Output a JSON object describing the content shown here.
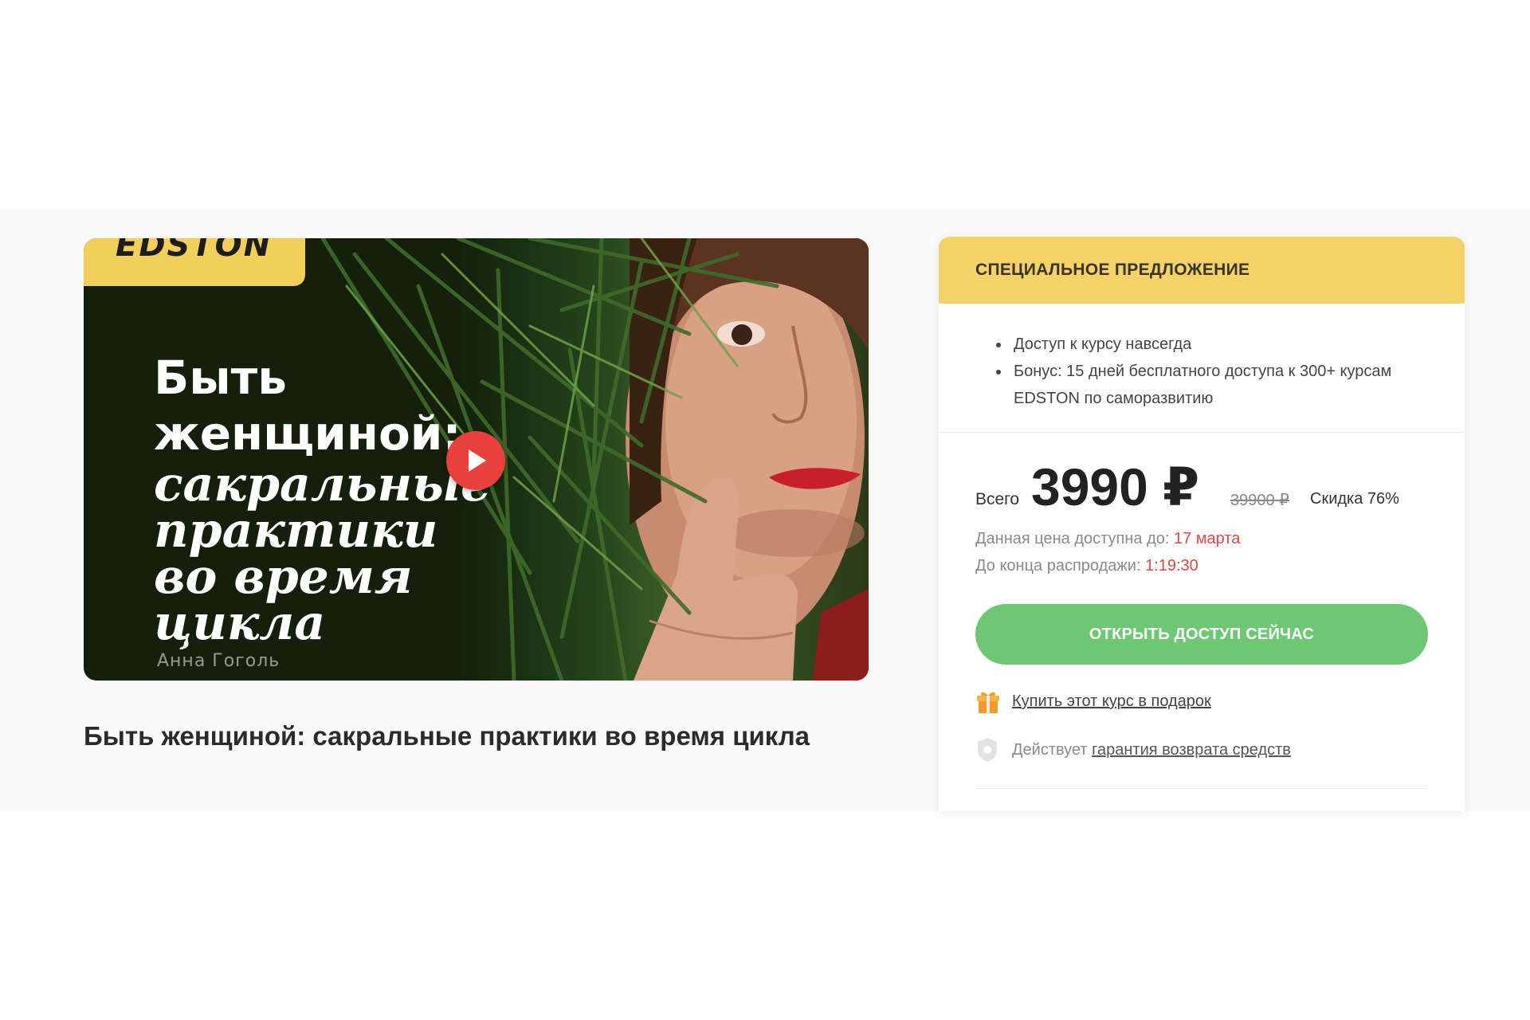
{
  "cover": {
    "brand": "EDSTON",
    "title_line1": "Быть\nженщиной:",
    "title_line2": "сакральные\nпрактики\nво время\nцикла",
    "author": "Анна Гоголь",
    "play_icon": "play-icon"
  },
  "course": {
    "name": "Быть женщиной: сакральные практики во время цикла"
  },
  "offer": {
    "header": "СПЕЦИАЛЬНОЕ ПРЕДЛОЖЕНИЕ",
    "benefits": [
      "Доступ к курсу навсегда",
      "Бонус: 15 дней бесплатного доступа к 300+ курсам EDSTON по саморазвитию"
    ],
    "total_label": "Всего",
    "price": "3990 ₽",
    "old_price": "39900 ₽",
    "discount": "Скидка 76%",
    "available_label": "Данная цена доступна до:",
    "available_date": "17 марта",
    "sale_end_label": "До конца распродажи:",
    "sale_end_timer": "1:19:30",
    "cta_label": "ОТКРЫТЬ ДОСТУП СЕЙЧАС",
    "gift_label": "Купить этот курс в подарок",
    "gift_icon": "gift-icon",
    "guarantee_prefix": "Действует",
    "guarantee_link": "гарантия возврата средств",
    "guarantee_icon": "shield-icon"
  },
  "colors": {
    "offer_header_bg": "#f4d267",
    "cta_bg": "#6ec873",
    "accent_red": "#e24646",
    "play_button": "#e8403a",
    "gift_orange": "#f29a2e"
  }
}
